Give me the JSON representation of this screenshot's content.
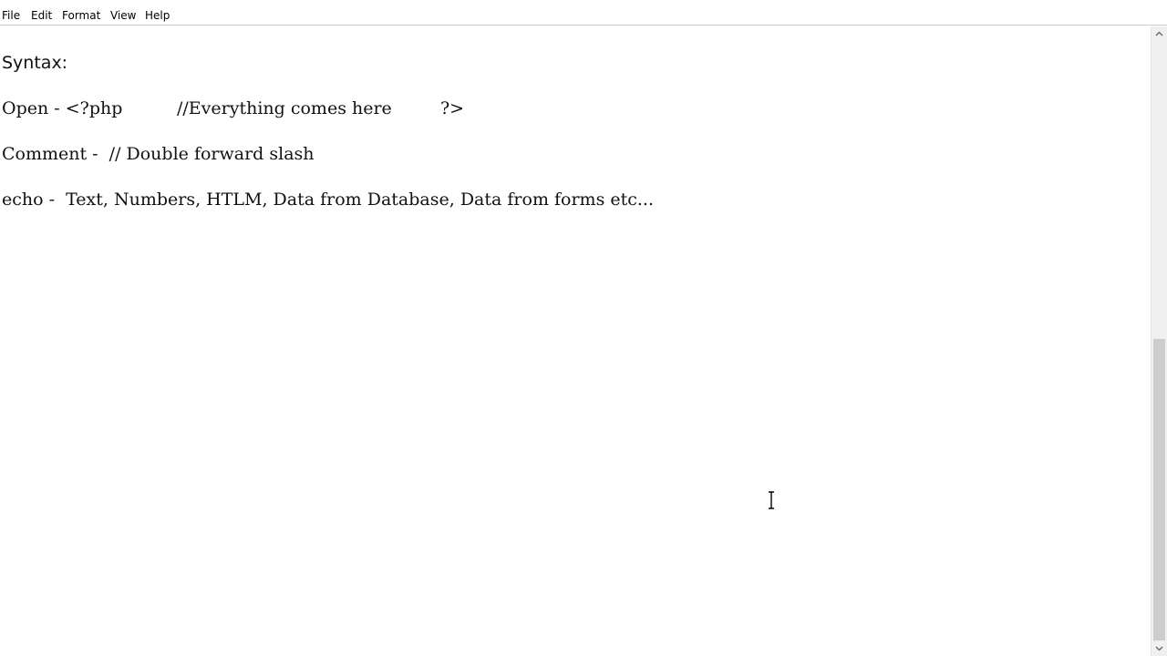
{
  "menubar": {
    "file": "File",
    "edit": "Edit",
    "format": "Format",
    "view": "View",
    "help": "Help"
  },
  "document": {
    "line1": "Syntax:",
    "line2": {
      "label": "Open - <?php",
      "comment": "//Everything comes here",
      "close": "?>"
    },
    "line3": "Comment -  // Double forward slash",
    "line4": "echo -  Text, Numbers, HTLM, Data from Database, Data from forms etc..."
  },
  "icons": {
    "cursor": "text-cursor-icon",
    "scroll_up": "chevron-up-icon",
    "scroll_down": "chevron-down-icon"
  },
  "colors": {
    "text": "#111111",
    "background": "#ffffff",
    "scroll_track": "#f0f0f0",
    "scroll_thumb": "#cdcdcd"
  }
}
